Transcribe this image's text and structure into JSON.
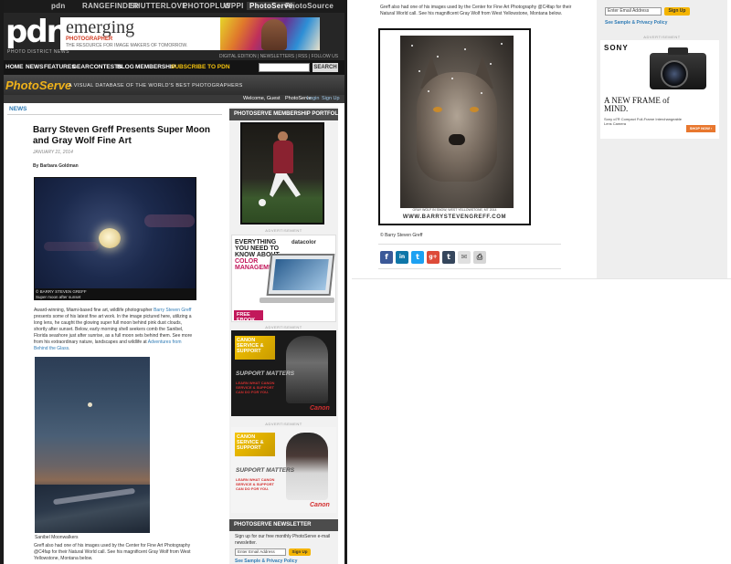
{
  "network": {
    "items": [
      "pdn",
      "RANGEFINDER",
      "SHUTTERLOVE",
      "PHOTOPLUS",
      "WPPI",
      "PhotoServe",
      "PhotoSource"
    ],
    "active_index": 5
  },
  "header": {
    "logo": "pdn",
    "tagline": "PHOTO DISTRICT NEWS",
    "banner_title": "emerging",
    "banner_sub": "PHOTOGRAPHER",
    "banner_tag": "THE RESOURCE FOR IMAGE MAKERS OF TOMORROW.",
    "edition_links": "DIGITAL EDITION | NEWSLETTERS | RSS | FOLLOW US"
  },
  "nav": {
    "items": [
      "HOME",
      "NEWS",
      "FEATURES",
      "GEAR",
      "CONTESTS",
      "BLOG",
      "MEMBERSHIP",
      "SUBSCRIBE TO PDN"
    ],
    "search_button": "SEARCH"
  },
  "photoserve": {
    "logo": "PhotoServe",
    "tagline": "A VISUAL DATABASE OF THE WORLD'S BEST PHOTOGRAPHERS",
    "welcome": "Welcome, Guest",
    "links": [
      "PhotoServe",
      "Login",
      "Sign Up"
    ]
  },
  "article": {
    "section": "NEWS",
    "title": "Barry Steven Greff Presents Super Moon and Gray Wolf Fine Art",
    "date": "JANUARY 21, 2014",
    "byline": "By Barbara Goldman",
    "moon_credit_line1": "© BARRY STEVEN GREFF",
    "moon_credit_line2": "Super moon after sunset",
    "body_1": "Award-winning, Miami-based fine art, wildlife photographer ",
    "body_link": "Barry Steven Greff",
    "body_2": " presents some of his latest fine art work. In the image pictured here, utilizing a long lens, he caught the glowing super full moon behind pink dust clouds, shortly after sunset. Below, early morning shell seekers comb the Sanibel, Florida seashore just after sunrise, as a full moon sets behind them. See more from his extraordinary nature, landscapes and wildlife at ",
    "body_link2": "Adventures from Behind the Glass",
    "body_3": ".",
    "sanibel_caption": "Sanibel Moonwalkers",
    "bottom_text": "Greff also had one of his images used by the Center for Fine Art Photography @C4fap for their Natural World call. See his magnificent Gray Wolf from West Yellowstone, Montana below."
  },
  "sidebar": {
    "portfolio_head": "PHOTOSERVE MEMBERSHIP PORTFOLIO",
    "ad_label": "ADVERTISEMENT",
    "datacolor": {
      "headline_1": "EVERYTHING YOU NEED TO KNOW ABOUT",
      "headline_2": "COLOR MANAGEMENT",
      "brand": "datacolor",
      "ribbon": "FREE EBOOK"
    },
    "canon": {
      "badge": "CANON SERVICE & SUPPORT",
      "matters": "SUPPORT MATTERS",
      "learn": "LEARN WHAT CANON SERVICE & SUPPORT CAN DO FOR YOU.",
      "logo": "Canon"
    },
    "newsletter_head": "PHOTOSERVE NEWSLETTER",
    "newsletter_text": "Sign up for our free monthly PhotoServe e-mail newsletter.",
    "email_placeholder": "Enter Email Address",
    "signup": "Sign Up",
    "privacy": "See Sample & Privacy Policy"
  },
  "right": {
    "top_text": "Greff also had one of his images used by the Center for Fine Art Photography @C4fap for their Natural World call. See his magnificent Gray Wolf from West Yellowstone, Montana below.",
    "wolf_caption": "GRAY WOLF IN SNOW, WEST YELLOWSTONE, MT 2014",
    "wolf_url": "WWW.BARRYSTEVENGREFF.COM",
    "wolf_credit": "© Barry Steven Greff",
    "social": [
      "f",
      "in",
      "t",
      "g+",
      "t",
      "✉",
      "⎙"
    ],
    "email_placeholder": "Enter Email Address",
    "signup": "Sign Up",
    "privacy": "See Sample & Privacy Policy",
    "ad_label": "ADVERTISEMENT",
    "sony": {
      "logo": "SONY",
      "headline": "A NEW FRAME of MIND.",
      "sub": "Sony α7R Compact Full-Frame Interchangeable Lens Camera",
      "shop": "SHOP NOW ›"
    }
  },
  "colors": {
    "accent_link": "#2f7bb5",
    "photoserve_gold": "#f0b21a",
    "signup_yellow": "#f4b400",
    "canon_red": "#d32f2f"
  }
}
